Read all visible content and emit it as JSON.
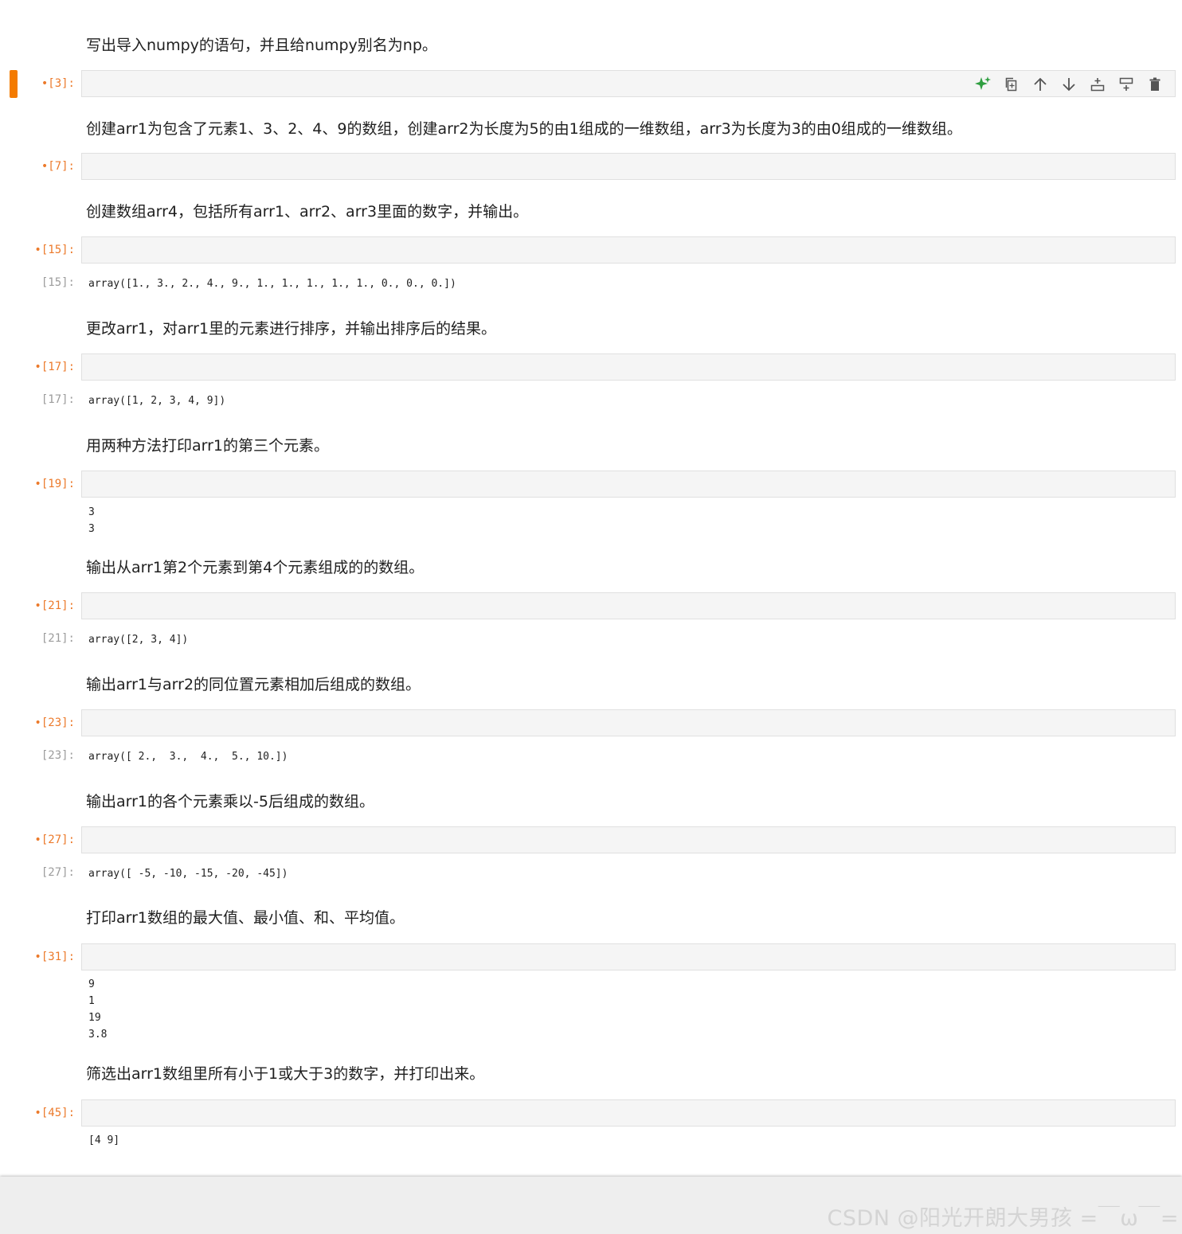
{
  "cells": [
    {
      "markdown": "写出导入numpy的语句，并且给numpy别名为np。",
      "prompt": "•[3]:",
      "output_prompt": "",
      "output": ""
    },
    {
      "markdown": "创建arr1为包含了元素1、3、2、4、9的数组，创建arr2为长度为5的由1组成的一维数组，arr3为长度为3的由0组成的一维数组。",
      "prompt": "•[7]:",
      "output_prompt": "",
      "output": ""
    },
    {
      "markdown": "创建数组arr4，包括所有arr1、arr2、arr3里面的数字，并输出。",
      "prompt": "•[15]:",
      "output_prompt": "[15]:",
      "output": "array([1., 3., 2., 4., 9., 1., 1., 1., 1., 1., 0., 0., 0.])"
    },
    {
      "markdown": "更改arr1，对arr1里的元素进行排序，并输出排序后的结果。",
      "prompt": "•[17]:",
      "output_prompt": "[17]:",
      "output": "array([1, 2, 3, 4, 9])"
    },
    {
      "markdown": "用两种方法打印arr1的第三个元素。",
      "prompt": "•[19]:",
      "output_prompt": "",
      "output": "3\n3"
    },
    {
      "markdown": "输出从arr1第2个元素到第4个元素组成的的数组。",
      "prompt": "•[21]:",
      "output_prompt": "[21]:",
      "output": "array([2, 3, 4])"
    },
    {
      "markdown": "输出arr1与arr2的同位置元素相加后组成的数组。",
      "prompt": "•[23]:",
      "output_prompt": "[23]:",
      "output": "array([ 2.,  3.,  4.,  5., 10.])"
    },
    {
      "markdown": "输出arr1的各个元素乘以-5后组成的数组。",
      "prompt": "•[27]:",
      "output_prompt": "[27]:",
      "output": "array([ -5, -10, -15, -20, -45])"
    },
    {
      "markdown": "打印arr1数组的最大值、最小值、和、平均值。",
      "prompt": "•[31]:",
      "output_prompt": "",
      "output": "9\n1\n19\n3.8"
    },
    {
      "markdown": "筛选出arr1数组里所有小于1或大于3的数字，并打印出来。",
      "prompt": "•[45]:",
      "output_prompt": "",
      "output": "[4 9]"
    }
  ],
  "toolbar": {
    "icons": [
      "sparkle-icon",
      "duplicate-icon",
      "arrow-up-icon",
      "arrow-down-icon",
      "insert-above-icon",
      "insert-below-icon",
      "delete-icon"
    ],
    "sparkle_color": "#2e9e3f",
    "icon_color": "#555555"
  },
  "active_marker_color": "#f47b00",
  "watermark": "CSDN @阳光开朗大男孩 =￣ω￣="
}
